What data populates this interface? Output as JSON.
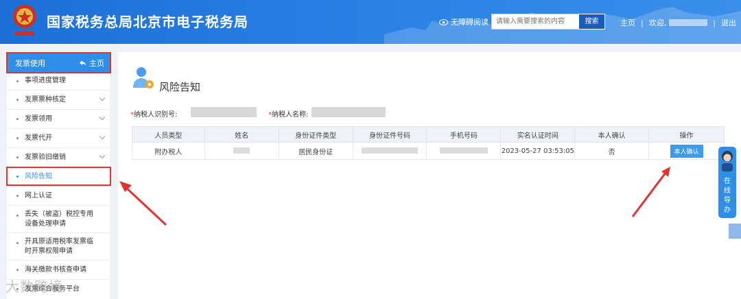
{
  "header": {
    "site_title": "国家税务总局北京市电子税务局",
    "accessibility_label": "无障碍阅读",
    "search_placeholder": "请输入需要搜索的内容",
    "search_button": "搜索",
    "home_link": "主页",
    "welcome_text": "欢迎,",
    "logout_link": "退出"
  },
  "sidebar": {
    "header_title": "发票使用",
    "header_home": "主页",
    "items": [
      {
        "label": "事项进度管理"
      },
      {
        "label": "发票票种核定"
      },
      {
        "label": "发票领用"
      },
      {
        "label": "发票代开"
      },
      {
        "label": "发票验旧缴销"
      },
      {
        "label": "风险告知"
      },
      {
        "label": "网上认证"
      },
      {
        "label": "丢失（被盗）税控专用设备处理申请"
      },
      {
        "label": "开具原适用税率发票临时开票权限申请"
      },
      {
        "label": "海关缴款书核查申请"
      },
      {
        "label": "发票综合服务平台"
      }
    ]
  },
  "main": {
    "page_title": "风险告知",
    "taxpayer_id_label": "纳税人识别号:",
    "taxpayer_name_label": "纳税人名称:",
    "required_mark": "*",
    "table": {
      "headers": [
        "人员类型",
        "姓名",
        "身份证件类型",
        "身份证件号码",
        "手机号码",
        "实名认证时间",
        "本人确认",
        "操作"
      ],
      "rows": [
        {
          "person_type": "附办税人",
          "id_type": "居民身份证",
          "auth_time": "2023-05-27 03:53:05",
          "confirmed": "否",
          "action": "本人确认"
        }
      ]
    }
  },
  "float_help": {
    "text": "在线导办"
  },
  "watermark": "大数跨境",
  "colors": {
    "primary": "#2f8ee8",
    "header": "#1d6fd6",
    "highlight": "#e23232"
  }
}
